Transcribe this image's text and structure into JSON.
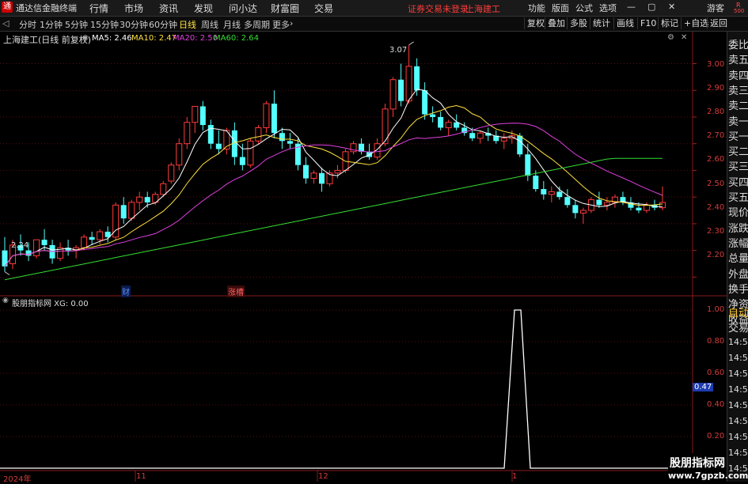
{
  "menubar": {
    "app_name": "通达信金融终端",
    "items": [
      "行情",
      "市场",
      "资讯",
      "发现",
      "问小达",
      "财富圈",
      "交易"
    ],
    "status": "证券交易未登录",
    "stock_name": "上海建工",
    "right_items": [
      "功能",
      "版面",
      "公式",
      "选项"
    ],
    "user": "游客"
  },
  "toolbar": {
    "periods": [
      "分时",
      "1分钟",
      "5分钟",
      "15分钟",
      "30分钟",
      "60分钟",
      "日线",
      "周线",
      "月线",
      "多周期",
      "更多"
    ],
    "active": "日线",
    "right_buttons": [
      "复权",
      "叠加",
      "多股",
      "统计",
      "画线",
      "F10",
      "标记",
      "+自选",
      "返回"
    ]
  },
  "main_chart": {
    "title": "上海建工(日线 前复权)",
    "ma": [
      {
        "label": "MA5: 2.46",
        "color": "#ffffff"
      },
      {
        "label": "MA10: 2.47",
        "color": "#ffe13d"
      },
      {
        "label": "MA20: 2.50",
        "color": "#e040e0"
      },
      {
        "label": "MA60: 2.64",
        "color": "#33dd33"
      }
    ],
    "high_label": "3.07",
    "low_label": "2.24",
    "events": [
      {
        "label": "财",
        "color": "#3b7bff"
      },
      {
        "label": "涨槽",
        "color": "#ff6060"
      }
    ]
  },
  "indicator": {
    "title": "股朋指标网 XG: 0.00",
    "current_value": "0.47"
  },
  "side_panel": {
    "labels": [
      "委比",
      "卖五",
      "卖四",
      "卖三",
      "卖二",
      "卖一",
      "买一",
      "买二",
      "买三",
      "买四",
      "买五",
      "现价",
      "涨跌",
      "涨幅",
      "总量",
      "外盘",
      "换手",
      "净资",
      "收益"
    ],
    "lower_labels": [
      "自动",
      "交易"
    ],
    "times": [
      "14:56",
      "14:56",
      "14:56",
      "14:56",
      "14:56",
      "14:56",
      "14:56",
      "14:56",
      "14:56"
    ]
  },
  "date_axis": [
    "2024年",
    "11",
    "12",
    "1"
  ],
  "price_axis": [
    "3.00",
    "2.90",
    "2.80",
    "2.70",
    "2.60",
    "2.50",
    "2.40",
    "2.30",
    "2.20"
  ],
  "indicator_axis": [
    "1.00",
    "0.80",
    "0.60",
    "0.40",
    "0.20"
  ],
  "watermark": {
    "line1": "股朋指标网",
    "line2": "www.7gpzb.com"
  },
  "chart_data": {
    "type": "candlestick",
    "ylim": [
      2.13,
      3.12
    ],
    "series_candles": [
      [
        2.3,
        2.35,
        2.22,
        2.24
      ],
      [
        2.25,
        2.34,
        2.23,
        2.32
      ],
      [
        2.32,
        2.36,
        2.28,
        2.3
      ],
      [
        2.3,
        2.33,
        2.26,
        2.28
      ],
      [
        2.28,
        2.34,
        2.27,
        2.34
      ],
      [
        2.34,
        2.38,
        2.3,
        2.32
      ],
      [
        2.32,
        2.34,
        2.25,
        2.27
      ],
      [
        2.27,
        2.33,
        2.26,
        2.31
      ],
      [
        2.31,
        2.34,
        2.28,
        2.3
      ],
      [
        2.3,
        2.32,
        2.27,
        2.31
      ],
      [
        2.31,
        2.36,
        2.3,
        2.35
      ],
      [
        2.35,
        2.37,
        2.32,
        2.34
      ],
      [
        2.34,
        2.38,
        2.32,
        2.37
      ],
      [
        2.37,
        2.39,
        2.33,
        2.35
      ],
      [
        2.35,
        2.48,
        2.34,
        2.47
      ],
      [
        2.47,
        2.5,
        2.4,
        2.42
      ],
      [
        2.42,
        2.49,
        2.41,
        2.48
      ],
      [
        2.48,
        2.52,
        2.45,
        2.5
      ],
      [
        2.5,
        2.52,
        2.46,
        2.48
      ],
      [
        2.48,
        2.52,
        2.47,
        2.51
      ],
      [
        2.51,
        2.56,
        2.5,
        2.55
      ],
      [
        2.56,
        2.63,
        2.55,
        2.62
      ],
      [
        2.62,
        2.72,
        2.6,
        2.7
      ],
      [
        2.7,
        2.8,
        2.68,
        2.78
      ],
      [
        2.78,
        2.84,
        2.74,
        2.84
      ],
      [
        2.84,
        2.86,
        2.75,
        2.77
      ],
      [
        2.77,
        2.79,
        2.68,
        2.7
      ],
      [
        2.7,
        2.75,
        2.66,
        2.68
      ],
      [
        2.68,
        2.76,
        2.66,
        2.75
      ],
      [
        2.75,
        2.78,
        2.62,
        2.65
      ],
      [
        2.65,
        2.7,
        2.6,
        2.62
      ],
      [
        2.62,
        2.72,
        2.61,
        2.71
      ],
      [
        2.71,
        2.77,
        2.7,
        2.76
      ],
      [
        2.76,
        2.86,
        2.74,
        2.85
      ],
      [
        2.85,
        2.9,
        2.72,
        2.74
      ],
      [
        2.74,
        2.76,
        2.68,
        2.71
      ],
      [
        2.71,
        2.74,
        2.68,
        2.7
      ],
      [
        2.7,
        2.72,
        2.6,
        2.62
      ],
      [
        2.62,
        2.65,
        2.55,
        2.57
      ],
      [
        2.57,
        2.6,
        2.55,
        2.59
      ],
      [
        2.59,
        2.61,
        2.52,
        2.55
      ],
      [
        2.55,
        2.6,
        2.54,
        2.59
      ],
      [
        2.59,
        2.62,
        2.57,
        2.6
      ],
      [
        2.6,
        2.68,
        2.59,
        2.67
      ],
      [
        2.67,
        2.71,
        2.66,
        2.7
      ],
      [
        2.7,
        2.72,
        2.66,
        2.67
      ],
      [
        2.67,
        2.7,
        2.64,
        2.65
      ],
      [
        2.65,
        2.72,
        2.64,
        2.7
      ],
      [
        2.7,
        2.85,
        2.69,
        2.83
      ],
      [
        2.83,
        2.95,
        2.8,
        2.94
      ],
      [
        2.94,
        3.0,
        2.84,
        2.86
      ],
      [
        2.86,
        3.07,
        2.85,
        2.99
      ],
      [
        2.99,
        3.02,
        2.88,
        2.9
      ],
      [
        2.9,
        2.93,
        2.79,
        2.81
      ],
      [
        2.81,
        2.84,
        2.78,
        2.8
      ],
      [
        2.8,
        2.82,
        2.75,
        2.76
      ],
      [
        2.76,
        2.79,
        2.73,
        2.78
      ],
      [
        2.78,
        2.81,
        2.75,
        2.76
      ],
      [
        2.76,
        2.78,
        2.73,
        2.74
      ],
      [
        2.74,
        2.76,
        2.71,
        2.72
      ],
      [
        2.72,
        2.75,
        2.7,
        2.74
      ],
      [
        2.74,
        2.76,
        2.71,
        2.73
      ],
      [
        2.73,
        2.75,
        2.7,
        2.71
      ],
      [
        2.71,
        2.74,
        2.68,
        2.72
      ],
      [
        2.72,
        2.75,
        2.7,
        2.73
      ],
      [
        2.73,
        2.74,
        2.65,
        2.66
      ],
      [
        2.66,
        2.7,
        2.56,
        2.58
      ],
      [
        2.58,
        2.6,
        2.52,
        2.53
      ],
      [
        2.53,
        2.56,
        2.49,
        2.51
      ],
      [
        2.51,
        2.54,
        2.48,
        2.52
      ],
      [
        2.52,
        2.54,
        2.49,
        2.5
      ],
      [
        2.5,
        2.53,
        2.46,
        2.47
      ],
      [
        2.47,
        2.49,
        2.42,
        2.44
      ],
      [
        2.44,
        2.46,
        2.4,
        2.45
      ],
      [
        2.45,
        2.5,
        2.44,
        2.49
      ],
      [
        2.49,
        2.52,
        2.46,
        2.47
      ],
      [
        2.47,
        2.5,
        2.45,
        2.48
      ],
      [
        2.48,
        2.51,
        2.46,
        2.5
      ],
      [
        2.5,
        2.52,
        2.47,
        2.48
      ],
      [
        2.48,
        2.5,
        2.45,
        2.46
      ],
      [
        2.46,
        2.48,
        2.44,
        2.45
      ],
      [
        2.45,
        2.48,
        2.44,
        2.47
      ],
      [
        2.47,
        2.49,
        2.45,
        2.46
      ],
      [
        2.46,
        2.54,
        2.45,
        2.48
      ]
    ]
  }
}
